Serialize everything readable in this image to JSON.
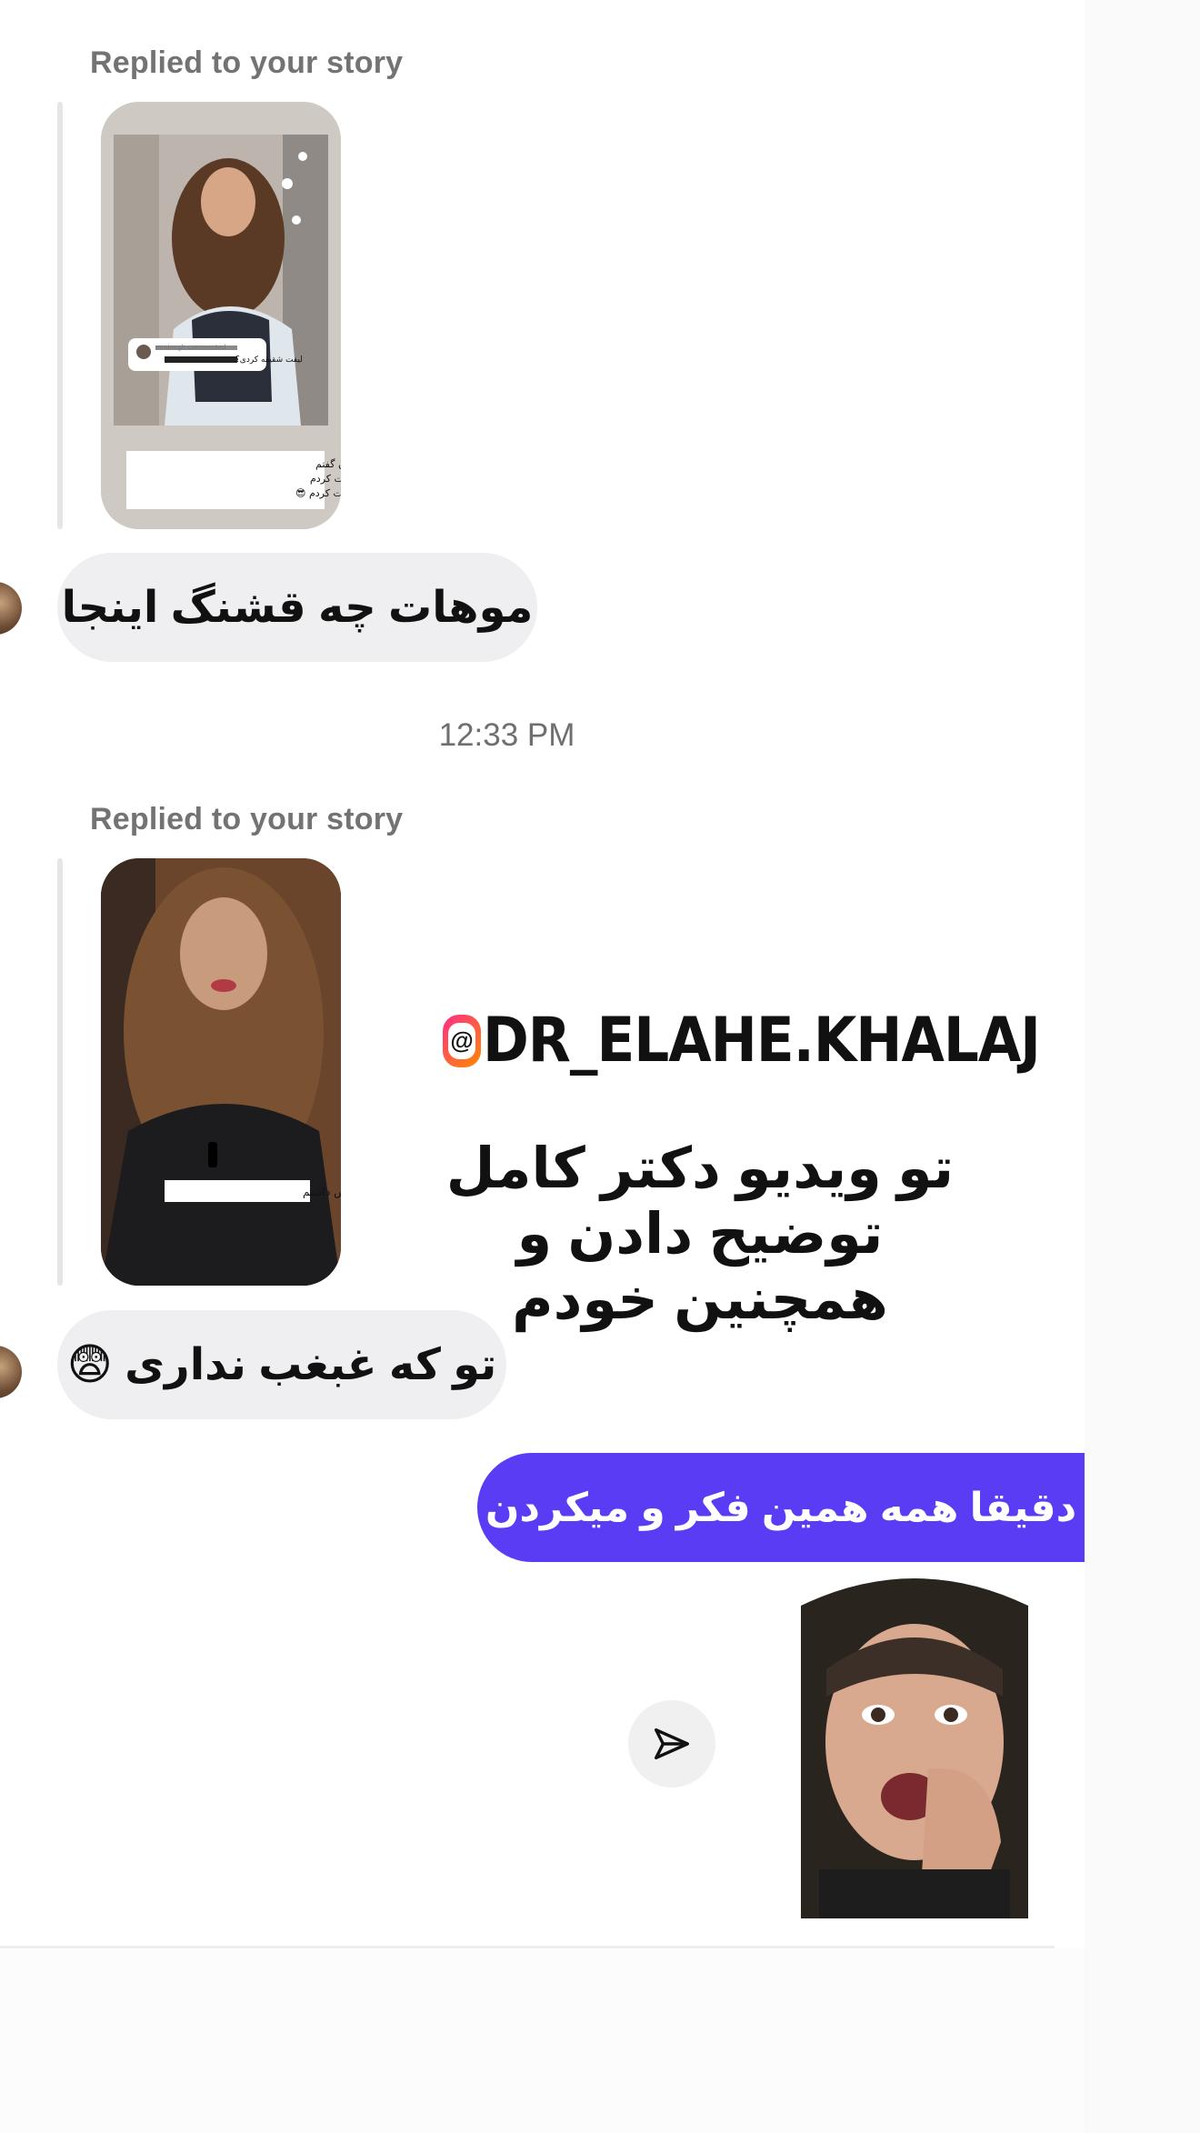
{
  "thread": {
    "replied_label_1": "Replied to your story",
    "replied_label_2": "Replied to your story",
    "story_1": {
      "caption_lines": [
        "ببین همین الان تو استوری قبل بهتون گفتم",
        "خیلی ها فکر میکردن من لیفت کردم",
        "در صورتی که کاشت کردم 😎"
      ],
      "comment_label": "mminegh commented",
      "comment_text": "لیفت شقیقه کردی؟"
    },
    "story_2": {
      "caption": "واقعیت من خیلی استرس داشتم"
    },
    "message_1": "موهات چه قشنگ اینجا",
    "timestamp": "12:33 PM",
    "message_2": "تو که غبغب نداری 😨",
    "message_out": "دقیقا همه همین فکر و میکردن",
    "overlay": {
      "handle": "DR_ELAHE.KHALAJ",
      "text": "تو ویدیو دکتر کامل توضیح دادن و همچنین خودم"
    }
  },
  "colors": {
    "outgoing_bubble": "#5b3cf5",
    "incoming_bubble": "#efeff1",
    "muted_text": "#737373"
  },
  "icons": {
    "send": "paper-plane-icon",
    "threads": "threads-logo-icon"
  }
}
